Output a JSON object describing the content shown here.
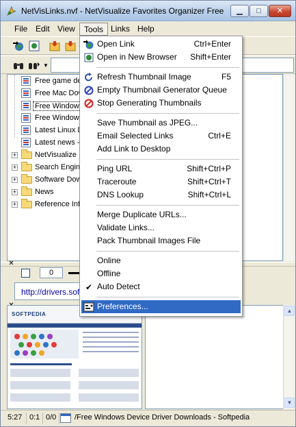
{
  "window": {
    "title": "NetVisLinks.nvf - NetVisualize Favorites Organizer Free"
  },
  "menubar": {
    "items": [
      "File",
      "Edit",
      "View",
      "Tools",
      "Links",
      "Help"
    ]
  },
  "tree": {
    "items": [
      {
        "label": "Free game de",
        "type": "link"
      },
      {
        "label": "Free Mac Dow",
        "type": "link"
      },
      {
        "label": "Free Windows",
        "type": "link",
        "selected": true
      },
      {
        "label": "Free Windows",
        "type": "link"
      },
      {
        "label": "Latest Linux D",
        "type": "link"
      },
      {
        "label": "Latest news - S",
        "type": "link"
      },
      {
        "label": "NetVisualize",
        "type": "folder"
      },
      {
        "label": "Search Engin",
        "type": "folder"
      },
      {
        "label": "Software Dow",
        "type": "folder"
      },
      {
        "label": "News",
        "type": "folder"
      },
      {
        "label": "Reference Info",
        "type": "folder"
      }
    ]
  },
  "controls": {
    "number_value": "0"
  },
  "url_bar": {
    "value": "http://drivers.softp"
  },
  "thumbnail": {
    "logo": "SOFTPEDIA"
  },
  "statusbar": {
    "time": "5:27",
    "ratio1": "0:1",
    "ratio2": "0/0",
    "title": "/Free Windows Device Driver Downloads - Softpedia"
  },
  "tools_menu": {
    "groups": [
      [
        {
          "label": "Open Link",
          "shortcut": "Ctrl+Enter",
          "icon": "globe-arrow-icon"
        },
        {
          "label": "Open in New Browser",
          "shortcut": "Shift+Enter",
          "icon": "globe-new-icon"
        }
      ],
      [
        {
          "label": "Refresh Thumbnail Image",
          "shortcut": "F5",
          "icon": "refresh-icon"
        },
        {
          "label": "Empty Thumbnail Generator Queue",
          "shortcut": "",
          "icon": "no-entry-blue-icon"
        },
        {
          "label": "Stop Generating Thumbnails",
          "shortcut": "",
          "icon": "no-entry-red-icon"
        }
      ],
      [
        {
          "label": "Save Thumbnail as JPEG...",
          "shortcut": "",
          "icon": ""
        },
        {
          "label": "Email Selected Links",
          "shortcut": "Ctrl+E",
          "icon": ""
        },
        {
          "label": "Add Link to Desktop",
          "shortcut": "",
          "icon": ""
        }
      ],
      [
        {
          "label": "Ping URL",
          "shortcut": "Shift+Ctrl+P",
          "icon": ""
        },
        {
          "label": "Traceroute",
          "shortcut": "Shift+Ctrl+T",
          "icon": ""
        },
        {
          "label": "DNS Lookup",
          "shortcut": "Shift+Ctrl+L",
          "icon": ""
        }
      ],
      [
        {
          "label": "Merge Duplicate URLs...",
          "shortcut": "",
          "icon": ""
        },
        {
          "label": "Validate Links...",
          "shortcut": "",
          "icon": ""
        },
        {
          "label": "Pack Thumbnail Images File",
          "shortcut": "",
          "icon": ""
        }
      ],
      [
        {
          "label": "Online",
          "shortcut": "",
          "icon": ""
        },
        {
          "label": "Offline",
          "shortcut": "",
          "icon": ""
        },
        {
          "label": "Auto Detect",
          "shortcut": "",
          "icon": "checkmark-icon"
        }
      ],
      [
        {
          "label": "Preferences...",
          "shortcut": "",
          "icon": "preferences-icon",
          "highlighted": true
        }
      ]
    ]
  },
  "colors": {
    "highlight": "#316ac5",
    "titlebar": "#b9d0ea",
    "window_bg": "#ece9d8"
  }
}
